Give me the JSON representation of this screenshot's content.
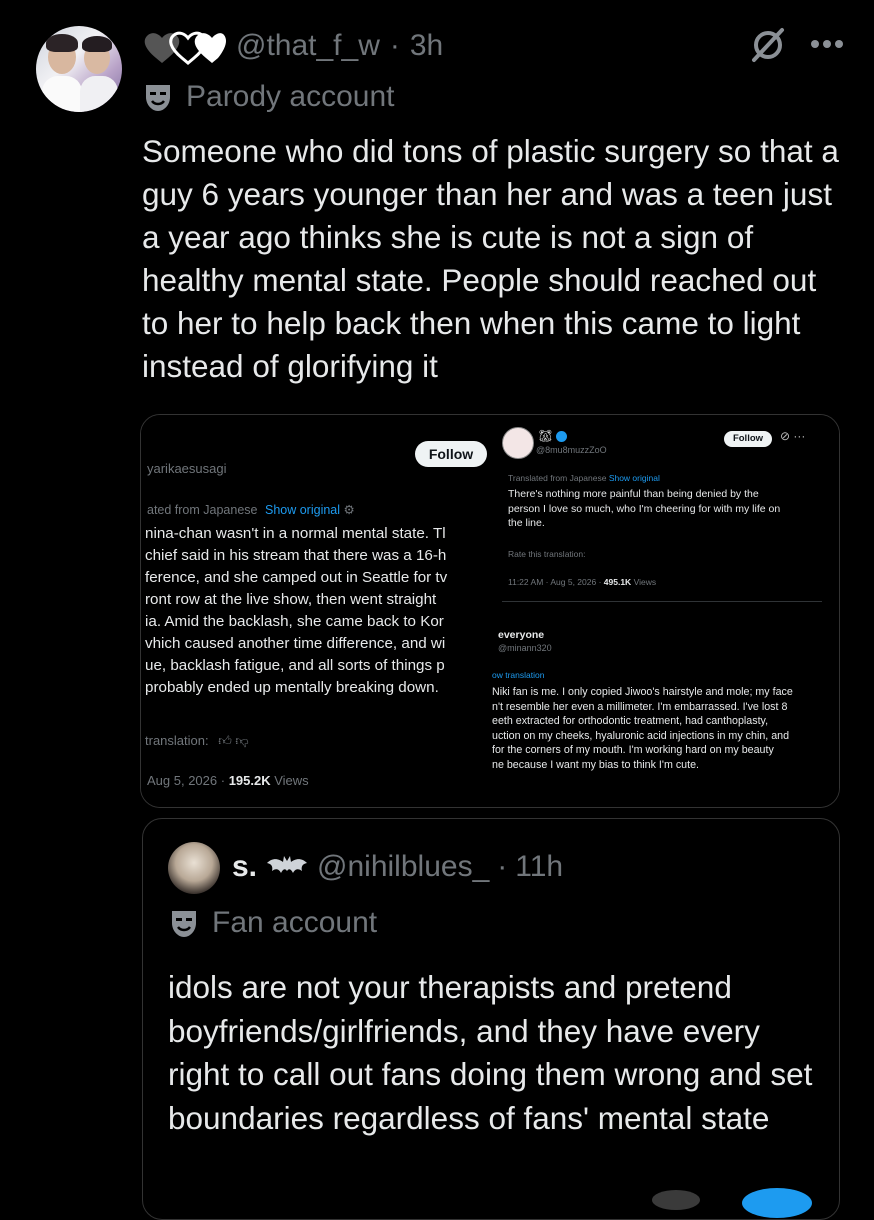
{
  "post": {
    "handle": "@that_f_w",
    "time": "3h",
    "badge": "Parody account",
    "text": "Someone who did tons of plastic surgery so that a guy 6 years younger than her and was a teen just a year ago thinks she is cute is not a sign of healthy mental state. People should reached out to her to help back then when this came to light instead of glorifying it"
  },
  "media_left": {
    "follow": "Follow",
    "handle": "yarikaesusagi",
    "translated": "ated from Japanese",
    "show_original": "Show original",
    "lines": [
      "nina-chan wasn't in a normal mental state. Tl",
      "chief said in his stream that there was a 16-h",
      "ference, and she camped out in Seattle for tv",
      "ront row at the live show, then went straight",
      "ia. Amid the backlash, she came back to Kor",
      "vhich caused another time difference, and wi",
      "ue, backlash fatigue, and all sorts of things p",
      "probably ended up mentally breaking down."
    ],
    "rate": "translation:",
    "date": "Aug 5, 2026 ·",
    "views_count": "195.2K",
    "views_label": "Views"
  },
  "media_right": {
    "follow": "Follow",
    "handle": "@8mu8muzzZoO",
    "translated": "Translated from Japanese",
    "show_original": "Show original",
    "lines": [
      "There's nothing more painful than being denied by the",
      "person I love so much, who I'm cheering for with my life on",
      "the line."
    ],
    "rate": "Rate this translation:",
    "time": "11:22 AM · Aug 5, 2026 ·",
    "views_count": "495.1K",
    "views_label": "Views",
    "reply_name": "everyone",
    "reply_handle": "@minann320",
    "reply_translation": "ow translation",
    "reply_lines": [
      "Niki fan is me. I only copied Jiwoo's hairstyle and mole; my face",
      "n't resemble her even a millimeter. I'm embarrassed. I've lost 8",
      "eeth extracted for orthodontic treatment, had canthoplasty,",
      "uction on my cheeks, hyaluronic acid injections in my chin, and",
      "for the corners of my mouth. I'm working hard on my beauty",
      "ne because I want my bias to think I'm cute."
    ]
  },
  "quote": {
    "name": "s.",
    "handle": "@nihilblues_",
    "time": "11h",
    "badge": "Fan account",
    "text": "idols are not your therapists and pretend boyfriends/girlfriends, and they have every right to call out fans doing them wrong and set boundaries regardless of fans' mental state"
  },
  "icons": {
    "hearts": "hearts-icon",
    "grok": "grok-icon",
    "more": "more-icon",
    "mask": "mask-icon",
    "bat": "bat-icon"
  }
}
